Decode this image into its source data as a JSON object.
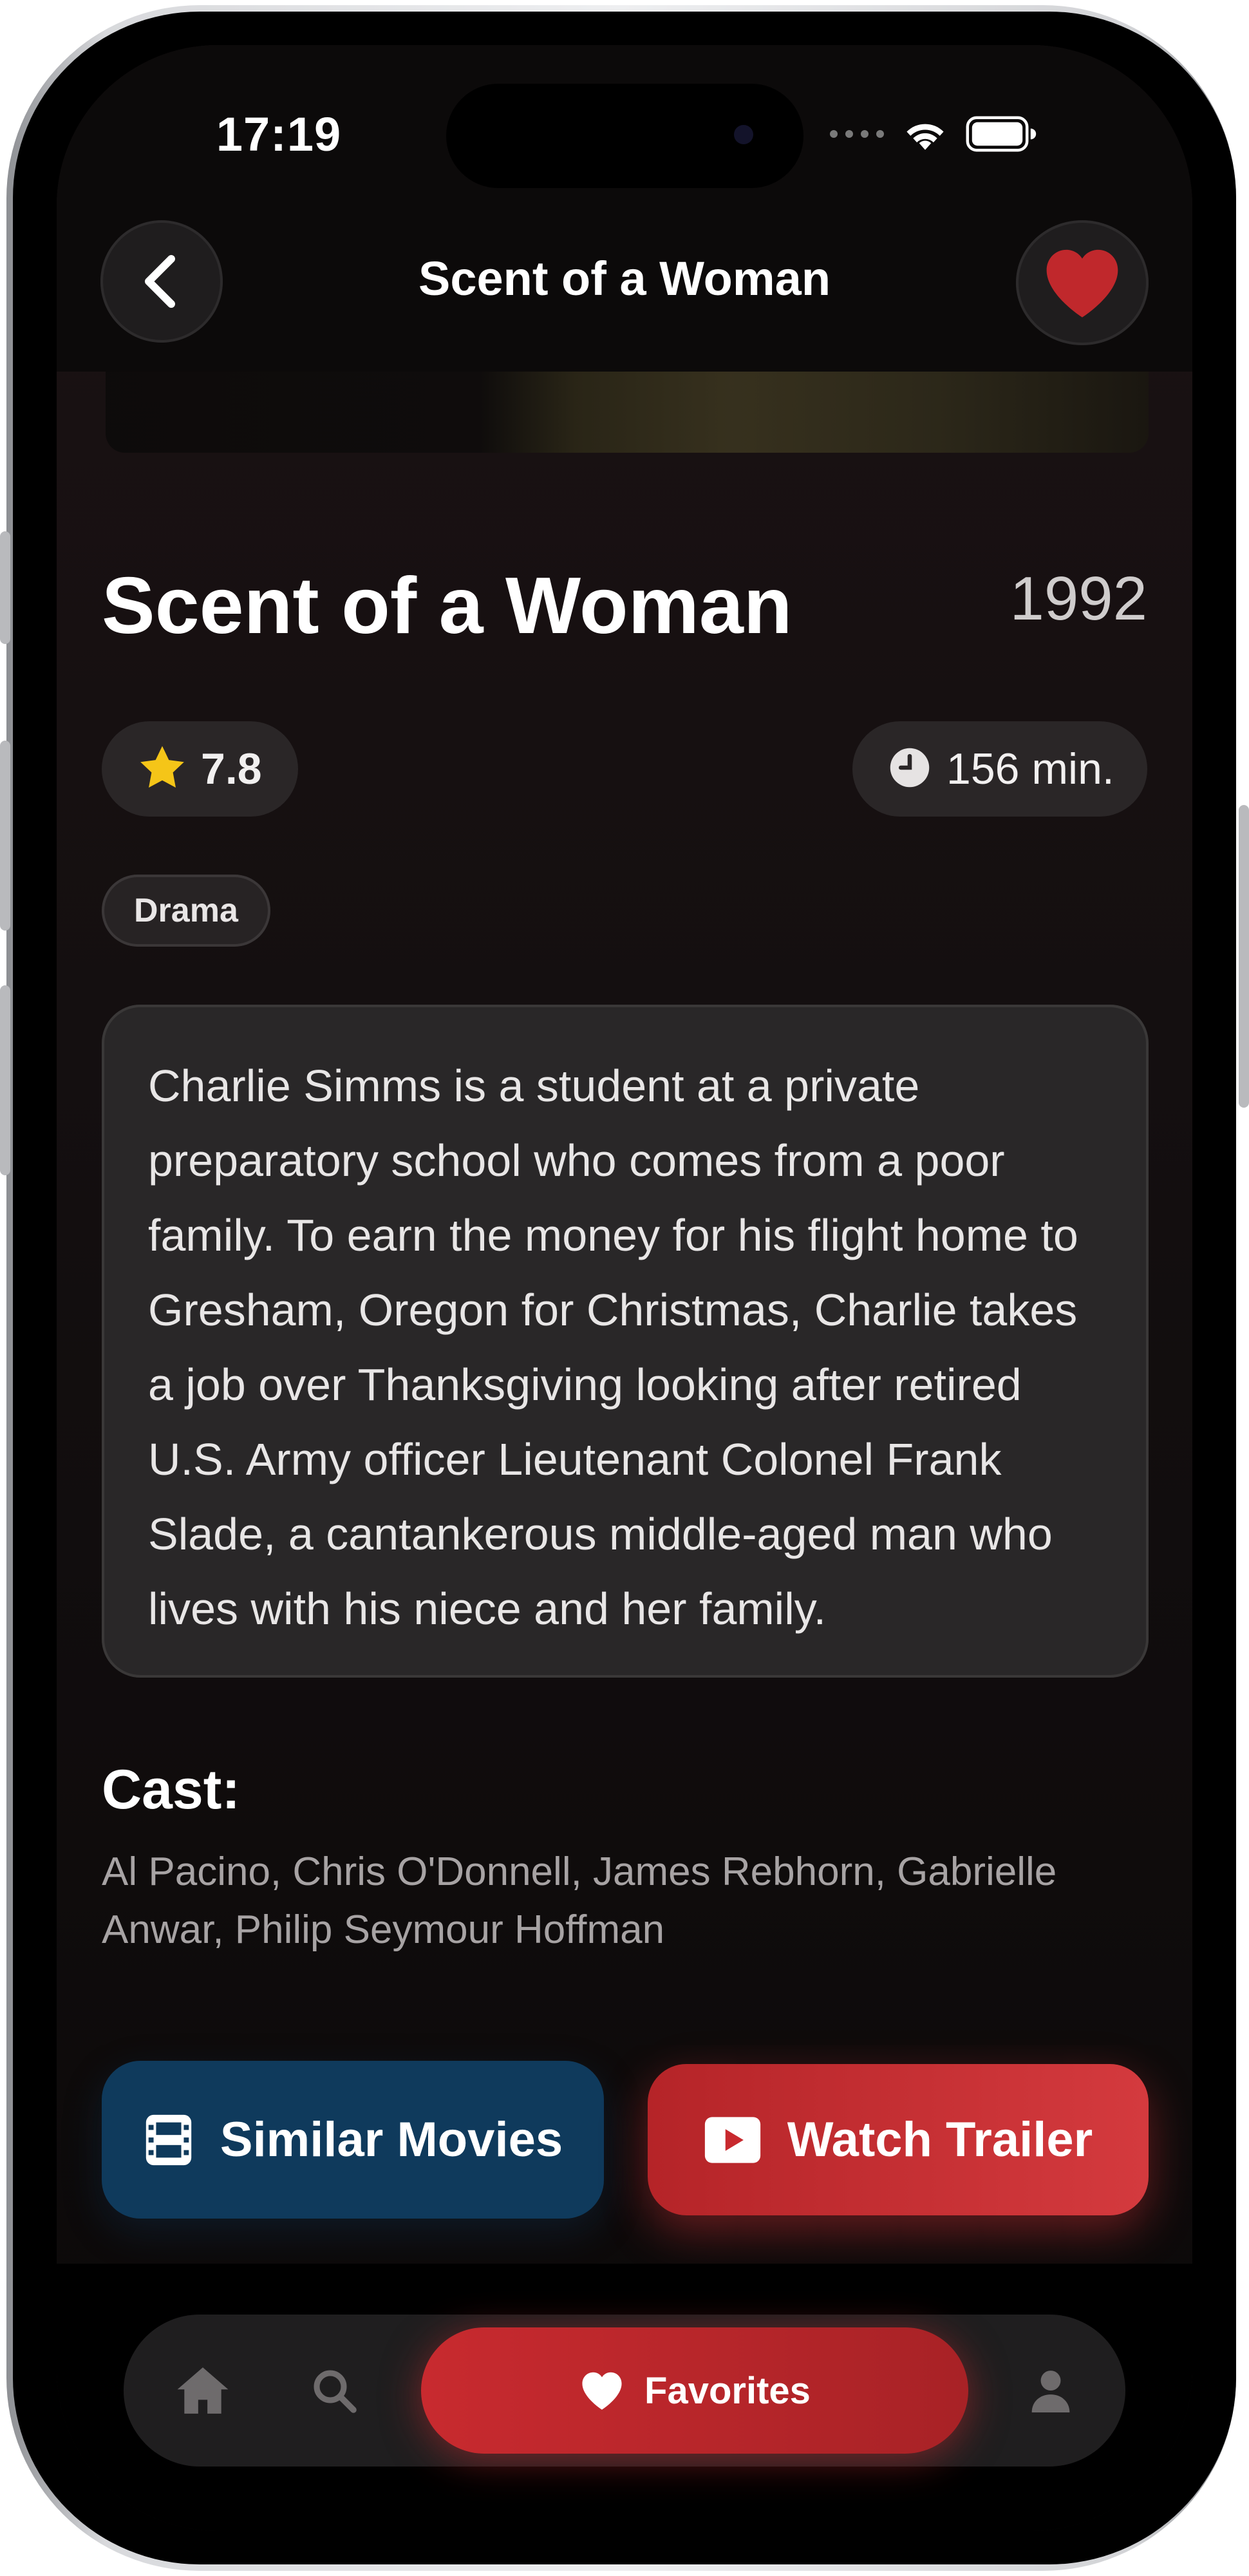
{
  "status_bar": {
    "time": "17:19",
    "icons": [
      "signal-dots-icon",
      "wifi-icon",
      "battery-icon"
    ]
  },
  "header": {
    "title": "Scent of a Woman",
    "back_icon": "chevron-left-icon",
    "favorite_icon": "heart-filled-icon",
    "favorite_active": true
  },
  "movie": {
    "title": "Scent of a Woman",
    "year": "1992",
    "rating": "7.8",
    "duration": "156 min.",
    "genres": [
      "Drama"
    ],
    "description": "Charlie Simms is a student at a private preparatory school who comes from a poor family. To earn the money for his flight home to Gresham, Oregon for Christmas, Charlie takes a job over Thanksgiving looking after retired U.S. Army officer Lieutenant Colonel Frank Slade, a cantankerous middle-aged man who lives with his niece and her family.",
    "cast_heading": "Cast:",
    "cast": "Al Pacino, Chris O'Donnell, James Rebhorn, Gabrielle Anwar, Philip Seymour Hoffman"
  },
  "actions": {
    "similar_label": "Similar Movies",
    "similar_icon": "film-icon",
    "trailer_label": "Watch Trailer",
    "trailer_icon": "play-icon"
  },
  "tabbar": {
    "tabs": [
      {
        "id": "home",
        "icon": "home-icon",
        "label": ""
      },
      {
        "id": "search",
        "icon": "search-icon",
        "label": ""
      },
      {
        "id": "favorites",
        "icon": "heart-icon",
        "label": "Favorites",
        "active": true
      },
      {
        "id": "profile",
        "icon": "person-icon",
        "label": ""
      }
    ]
  },
  "colors": {
    "accent_red": "#c8292e",
    "similar_blue": "#0f3a5c",
    "star_yellow": "#f5c518",
    "background": "#0b0809"
  }
}
